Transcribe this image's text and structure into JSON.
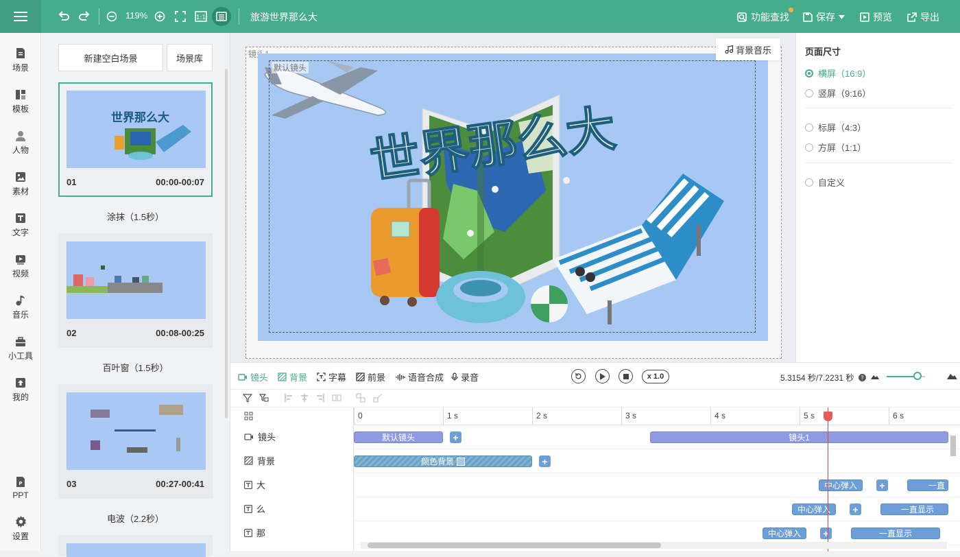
{
  "topbar": {
    "zoom": "119%",
    "project_title": "旅游世界那么大",
    "feature_search": "功能查找",
    "save": "保存",
    "preview": "预览",
    "export": "导出"
  },
  "nav": [
    {
      "label": "场景",
      "icon": "scene-icon"
    },
    {
      "label": "模板",
      "icon": "template-icon"
    },
    {
      "label": "人物",
      "icon": "person-icon"
    },
    {
      "label": "素材",
      "icon": "material-icon"
    },
    {
      "label": "文字",
      "icon": "text-icon"
    },
    {
      "label": "视频",
      "icon": "video-icon"
    },
    {
      "label": "音乐",
      "icon": "music-icon"
    },
    {
      "label": "小工具",
      "icon": "toolbox-icon"
    },
    {
      "label": "我的",
      "icon": "upload-icon"
    },
    {
      "label": "PPT",
      "icon": "ppt-icon"
    },
    {
      "label": "设置",
      "icon": "gear-icon"
    }
  ],
  "scenes": {
    "new_blank": "新建空白场景",
    "library": "场景库",
    "items": [
      {
        "num": "01",
        "time": "00:00-00:07",
        "transition": "涂抹（1.5秒）",
        "thumb_title": "世界那么大"
      },
      {
        "num": "02",
        "time": "00:08-00:25",
        "transition": "百叶窗（1.5秒）"
      },
      {
        "num": "03",
        "time": "00:27-00:41",
        "transition": "电波（2.2秒）"
      }
    ]
  },
  "canvas": {
    "lens_label": "镜头1",
    "default_lens_label": "默认镜头",
    "bgm": "背景音乐",
    "headline": "世界那么大"
  },
  "props": {
    "title": "页面尺寸",
    "options": [
      {
        "label": "横屏（16:9）",
        "selected": true
      },
      {
        "label": "竖屏（9:16）",
        "selected": false
      },
      {
        "label": "标屏（4:3）",
        "selected": false
      },
      {
        "label": "方屏（1:1）",
        "selected": false
      },
      {
        "label": "自定义",
        "selected": false
      }
    ]
  },
  "timeline": {
    "tabs": [
      "镜头",
      "背景",
      "字幕",
      "前景",
      "语音合成",
      "录音"
    ],
    "speed": "x 1.0",
    "time_readout": "5.3154 秒/7.2231 秒",
    "zoom_fraction": 0.8,
    "playhead_seconds": 5.3154,
    "ruler": [
      "0",
      "1 s",
      "2 s",
      "3 s",
      "4 s",
      "5 s",
      "6 s"
    ],
    "rows": [
      {
        "label": "镜头",
        "icon": "camera-icon"
      },
      {
        "label": "背景",
        "icon": "background-icon"
      },
      {
        "label": "大",
        "icon": "text-track-icon"
      },
      {
        "label": "么",
        "icon": "text-track-icon"
      },
      {
        "label": "那",
        "icon": "text-track-icon"
      }
    ],
    "clips": {
      "lens_default": "默认镜头",
      "lens_1": "镜头1",
      "bg_color": "颜色背景",
      "da_pop": "中心弹入",
      "da_show": "一直",
      "me_pop": "中心弹入",
      "me_show": "一直显示",
      "na_pop": "中心弹入",
      "na_show": "一直显示"
    }
  },
  "colors": {
    "brand": "#46ad8c",
    "lens_clip": "#8e9be0",
    "text_clip": "#6c9fd8",
    "playhead": "#e34040"
  }
}
